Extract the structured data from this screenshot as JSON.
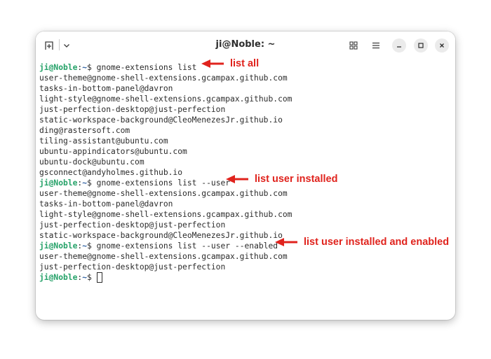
{
  "window": {
    "title": "ji@Noble: ~"
  },
  "titlebar": {
    "icons": [
      "new-tab-icon",
      "chevron-down-icon",
      "grid-view-icon",
      "hamburger-menu-icon",
      "minimize-icon",
      "maximize-icon",
      "close-icon"
    ]
  },
  "prompt": {
    "user": "ji@Noble",
    "sep": ":",
    "path": "~",
    "symbol": "$ "
  },
  "commands": [
    "gnome-extensions list",
    "gnome-extensions list --user",
    "gnome-extensions list --user --enabled"
  ],
  "output_all": [
    "user-theme@gnome-shell-extensions.gcampax.github.com",
    "tasks-in-bottom-panel@davron",
    "light-style@gnome-shell-extensions.gcampax.github.com",
    "just-perfection-desktop@just-perfection",
    "static-workspace-background@CleoMenezesJr.github.io",
    "ding@rastersoft.com",
    "tiling-assistant@ubuntu.com",
    "ubuntu-appindicators@ubuntu.com",
    "ubuntu-dock@ubuntu.com",
    "gsconnect@andyholmes.github.io"
  ],
  "output_user": [
    "user-theme@gnome-shell-extensions.gcampax.github.com",
    "tasks-in-bottom-panel@davron",
    "light-style@gnome-shell-extensions.gcampax.github.com",
    "just-perfection-desktop@just-perfection",
    "static-workspace-background@CleoMenezesJr.github.io"
  ],
  "output_enabled": [
    "user-theme@gnome-shell-extensions.gcampax.github.com",
    "just-perfection-desktop@just-perfection"
  ],
  "annotations": [
    "list all",
    "list user installed",
    "list user installed and enabled"
  ],
  "colors": {
    "prompt_user": "#26a269",
    "prompt_path": "#3465a4",
    "annotation": "#e0231d"
  }
}
